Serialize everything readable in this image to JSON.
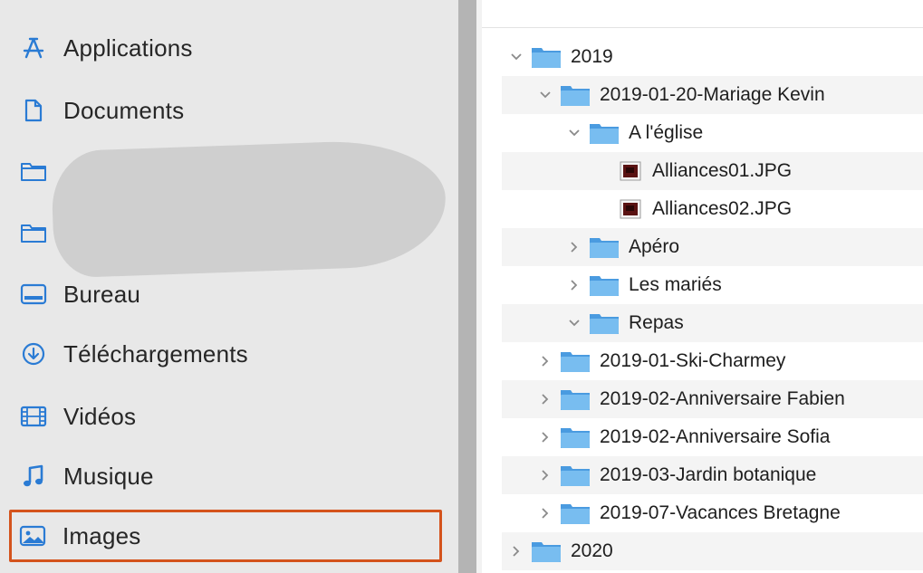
{
  "sidebar": {
    "items": [
      {
        "label": "Applications",
        "icon": "applications-icon"
      },
      {
        "label": "Documents",
        "icon": "document-icon"
      },
      {
        "label": "",
        "icon": "folder-icon"
      },
      {
        "label": "",
        "icon": "folder-icon"
      },
      {
        "label": "Bureau",
        "icon": "desktop-icon"
      },
      {
        "label": "Téléchargements",
        "icon": "download-icon"
      },
      {
        "label": "Vidéos",
        "icon": "film-icon"
      },
      {
        "label": "Musique",
        "icon": "music-note-icon"
      },
      {
        "label": "Images",
        "icon": "photo-icon"
      }
    ],
    "selected": "Images"
  },
  "tree": {
    "rows": [
      {
        "label": "2019",
        "kind": "folder",
        "expanded": true
      },
      {
        "label": "2019-01-20-Mariage Kevin",
        "kind": "folder",
        "expanded": true
      },
      {
        "label": "A l'église",
        "kind": "folder",
        "expanded": true
      },
      {
        "label": "Alliances01.JPG",
        "kind": "image-file"
      },
      {
        "label": "Alliances02.JPG",
        "kind": "image-file"
      },
      {
        "label": "Apéro",
        "kind": "folder",
        "expanded": false
      },
      {
        "label": "Les mariés",
        "kind": "folder",
        "expanded": false
      },
      {
        "label": "Repas",
        "kind": "folder",
        "expanded": true
      },
      {
        "label": "2019-01-Ski-Charmey",
        "kind": "folder",
        "expanded": false
      },
      {
        "label": "2019-02-Anniversaire Fabien",
        "kind": "folder",
        "expanded": false
      },
      {
        "label": "2019-02-Anniversaire Sofia",
        "kind": "folder",
        "expanded": false
      },
      {
        "label": "2019-03-Jardin botanique",
        "kind": "folder",
        "expanded": false
      },
      {
        "label": "2019-07-Vacances Bretagne",
        "kind": "folder",
        "expanded": false
      },
      {
        "label": "2020",
        "kind": "folder",
        "expanded": false
      }
    ]
  },
  "colors": {
    "accent_blue": "#2a7bd4",
    "folder_blue": "#6fb6ec",
    "selection_border": "#d4531c"
  }
}
